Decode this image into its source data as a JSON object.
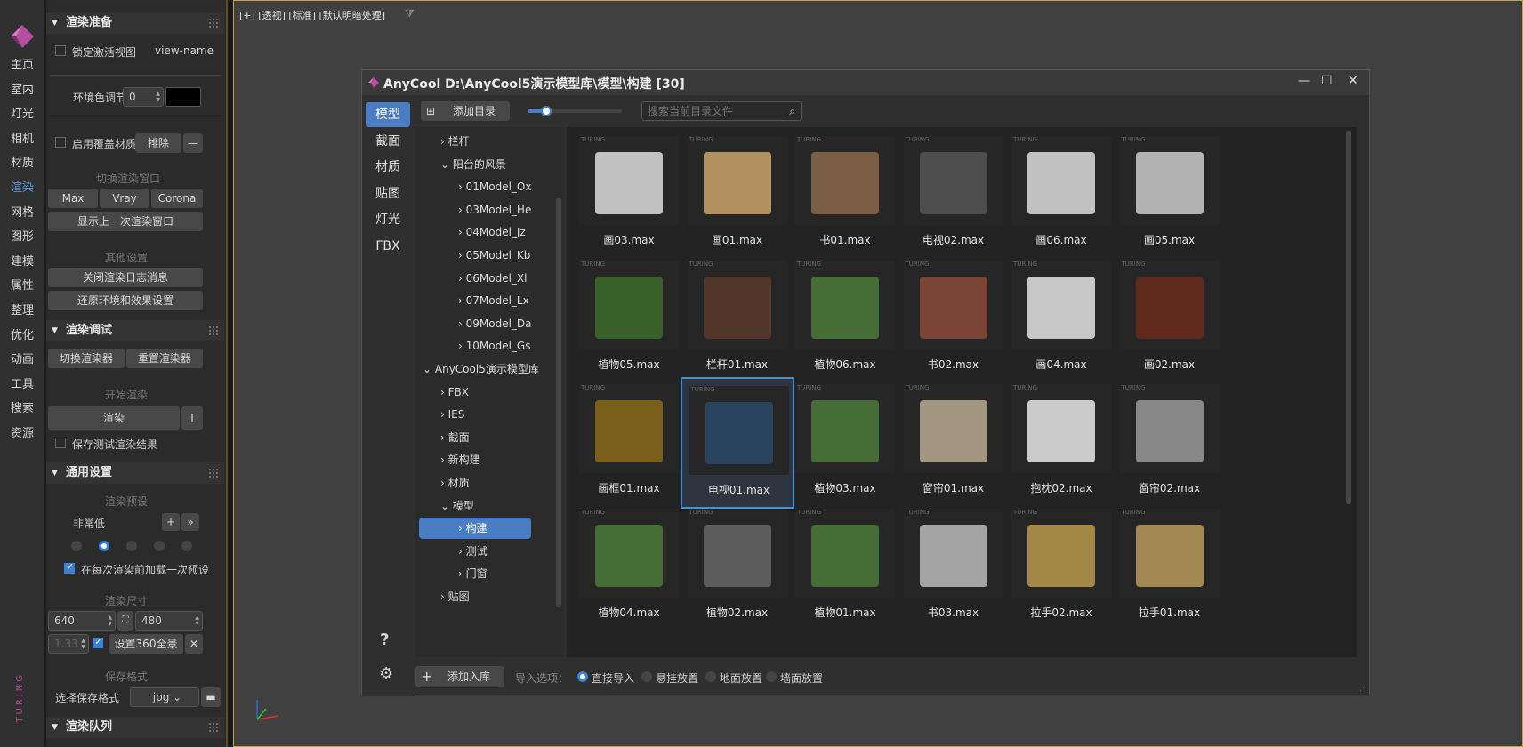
{
  "nav": {
    "items": [
      "主页",
      "室内",
      "灯光",
      "相机",
      "材质",
      "渲染",
      "网格",
      "图形",
      "建模",
      "属性",
      "整理",
      "优化",
      "动画",
      "工具",
      "搜索",
      "资源"
    ],
    "active_index": 5,
    "brand_vertical": "TURING"
  },
  "panel": {
    "render_prep": {
      "title": "渲染准备",
      "lock_view_label": "锁定激活视图",
      "view_name": "view-name",
      "env_color_label": "环境色调节",
      "env_color_value": "0",
      "override_mat_label": "启用覆盖材质",
      "exclude_label": "排除",
      "minus_label": "—",
      "switch_window_label": "切换渲染窗口",
      "renderers": [
        "Max",
        "Vray",
        "Corona"
      ],
      "show_last_window": "显示上一次渲染窗口",
      "other_settings_label": "其他设置",
      "close_log": "关闭渲染日志消息",
      "restore_env": "还原环境和效果设置"
    },
    "render_debug": {
      "title": "渲染调试",
      "switch_renderer": "切换渲染器",
      "reset_renderer": "重置渲染器",
      "start_render_label": "开始渲染",
      "render_button": "渲染",
      "render_extra": "I",
      "save_test_label": "保存测试渲染结果"
    },
    "general": {
      "title": "通用设置",
      "preset_label": "渲染预设",
      "preset_value": "非常低",
      "plus": "+",
      "more": "»",
      "preset_dots_selected": 1,
      "load_preset_label": "在每次渲染前加载一次预设",
      "size_label": "渲染尺寸",
      "width": "640",
      "height": "480",
      "ratio": "1.33",
      "set360": "设置360全景",
      "save_format_label": "保存格式",
      "choose_format_label": "选择保存格式",
      "format": "jpg"
    },
    "queue": {
      "title": "渲染队列"
    }
  },
  "viewport": {
    "label": "[+] [透视] [标准] [默认明暗处理]"
  },
  "window": {
    "title": "AnyCool D:\\AnyCool5演示模型库\\模型\\构建  [30]",
    "tabs": [
      "模型",
      "截面",
      "材质",
      "贴图",
      "灯光",
      "FBX"
    ],
    "active_tab": 0,
    "help": "?",
    "add_dir": "添加目录",
    "slider_value": 0.2,
    "search_placeholder": "搜索当前目录文件",
    "tree": [
      {
        "label": "栏杆",
        "level": 1,
        "open": false
      },
      {
        "label": "阳台的风景",
        "level": 1,
        "open": true
      },
      {
        "label": "01Model_Ox",
        "level": 2,
        "open": false
      },
      {
        "label": "03Model_He",
        "level": 2,
        "open": false
      },
      {
        "label": "04Model_Jz",
        "level": 2,
        "open": false
      },
      {
        "label": "05Model_Kb",
        "level": 2,
        "open": false
      },
      {
        "label": "06Model_Xl",
        "level": 2,
        "open": false
      },
      {
        "label": "07Model_Lx",
        "level": 2,
        "open": false
      },
      {
        "label": "09Model_Da",
        "level": 2,
        "open": false
      },
      {
        "label": "10Model_Gs",
        "level": 2,
        "open": false
      },
      {
        "label": "AnyCool5演示模型库",
        "level": 0,
        "open": true
      },
      {
        "label": "FBX",
        "level": 1,
        "open": false
      },
      {
        "label": "IES",
        "level": 1,
        "open": false
      },
      {
        "label": "截面",
        "level": 1,
        "open": false
      },
      {
        "label": "新构建",
        "level": 1,
        "open": false
      },
      {
        "label": "材质",
        "level": 1,
        "open": false
      },
      {
        "label": "模型",
        "level": 1,
        "open": true
      },
      {
        "label": "构建",
        "level": 2,
        "open": false,
        "selected": true
      },
      {
        "label": "测试",
        "level": 2,
        "open": false
      },
      {
        "label": "门窗",
        "level": 2,
        "open": false
      },
      {
        "label": "贴图",
        "level": 1,
        "open": false
      }
    ],
    "files": [
      {
        "name": "画03.max",
        "kind": "frames-wall"
      },
      {
        "name": "画01.max",
        "kind": "two-frames"
      },
      {
        "name": "书01.max",
        "kind": "books-row"
      },
      {
        "name": "电视02.max",
        "kind": "tv"
      },
      {
        "name": "画06.max",
        "kind": "frames-wall"
      },
      {
        "name": "画05.max",
        "kind": "tiles"
      },
      {
        "name": "植物05.max",
        "kind": "plants"
      },
      {
        "name": "栏杆01.max",
        "kind": "railing"
      },
      {
        "name": "植物06.max",
        "kind": "plant"
      },
      {
        "name": "书02.max",
        "kind": "books"
      },
      {
        "name": "画04.max",
        "kind": "frames-grid"
      },
      {
        "name": "画02.max",
        "kind": "frame"
      },
      {
        "name": "画框01.max",
        "kind": "empty-frame"
      },
      {
        "name": "电视01.max",
        "kind": "tv-on",
        "selected": true
      },
      {
        "name": "植物03.max",
        "kind": "plant"
      },
      {
        "name": "窗帘01.max",
        "kind": "curtain"
      },
      {
        "name": "抱枕02.max",
        "kind": "pillows"
      },
      {
        "name": "窗帘02.max",
        "kind": "curtain-grey"
      },
      {
        "name": "植物04.max",
        "kind": "plant"
      },
      {
        "name": "植物02.max",
        "kind": "plant-stand"
      },
      {
        "name": "植物01.max",
        "kind": "plant"
      },
      {
        "name": "书03.max",
        "kind": "books-grey"
      },
      {
        "name": "拉手02.max",
        "kind": "ring"
      },
      {
        "name": "拉手01.max",
        "kind": "handle"
      }
    ],
    "watermark": "TURING",
    "add_lib": "添加入库",
    "import_label": "导入选项：",
    "import_options": [
      "直接导入",
      "悬挂放置",
      "地面放置",
      "墙面放置"
    ],
    "import_selected": 0
  }
}
